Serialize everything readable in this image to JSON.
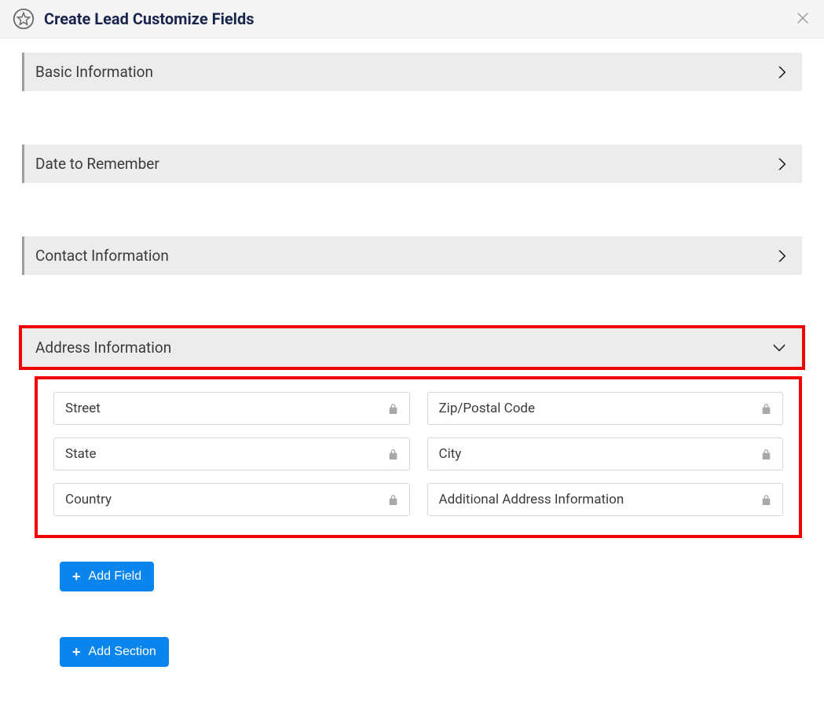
{
  "header": {
    "title": "Create Lead Customize Fields"
  },
  "sections": {
    "basic": {
      "title": "Basic Information",
      "expanded": false
    },
    "date": {
      "title": "Date to Remember",
      "expanded": false
    },
    "contact": {
      "title": "Contact Information",
      "expanded": false
    },
    "address": {
      "title": "Address Information",
      "expanded": true,
      "fields": {
        "f0": {
          "label": "Street",
          "locked": true
        },
        "f1": {
          "label": "Zip/Postal Code",
          "locked": true
        },
        "f2": {
          "label": "State",
          "locked": true
        },
        "f3": {
          "label": "City",
          "locked": true
        },
        "f4": {
          "label": "Country",
          "locked": true
        },
        "f5": {
          "label": "Additional Address Information",
          "locked": true
        }
      }
    }
  },
  "buttons": {
    "add_field": "Add Field",
    "add_section": "Add Section"
  }
}
